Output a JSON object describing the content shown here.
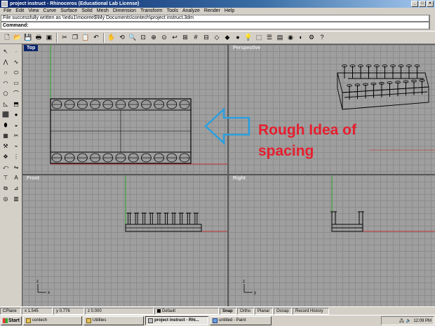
{
  "window": {
    "title": "project instruct - Rhinoceros (Educational Lab License)",
    "minimize": "_",
    "maximize": "□",
    "close": "×"
  },
  "menu": [
    "File",
    "Edit",
    "View",
    "Curve",
    "Surface",
    "Solid",
    "Mesh",
    "Dimension",
    "Transform",
    "Tools",
    "Analyze",
    "Render",
    "Help"
  ],
  "command": {
    "history": "File successfully written as \\\\edu1\\mooree$\\My Documents\\contech\\project instruct.3dm",
    "prompt": "Command:"
  },
  "viewports": {
    "top": "Top",
    "perspective": "Perspective",
    "front": "Front",
    "right": "Right"
  },
  "annotation": {
    "line1": "Rough Idea of",
    "line2": "spacing"
  },
  "status": {
    "cplane": "CPlane",
    "x": "x 1.545",
    "y": "y 0.776",
    "z": "z 0.000",
    "layer": "Default",
    "snap": "Snap",
    "ortho": "Ortho",
    "planar": "Planar",
    "osnap": "Osnap",
    "record": "Record History"
  },
  "taskbar": {
    "start": "Start",
    "items": [
      "contech",
      "Utilities",
      "project instruct - Rhi...",
      "untitled - Paint"
    ],
    "clock": "12:09 PM"
  },
  "colors": {
    "accent": "#0a246a",
    "annotation": "#e61e2e",
    "arrow": "#2aa0e0",
    "x_axis": "#c03030",
    "y_axis": "#30a030"
  }
}
